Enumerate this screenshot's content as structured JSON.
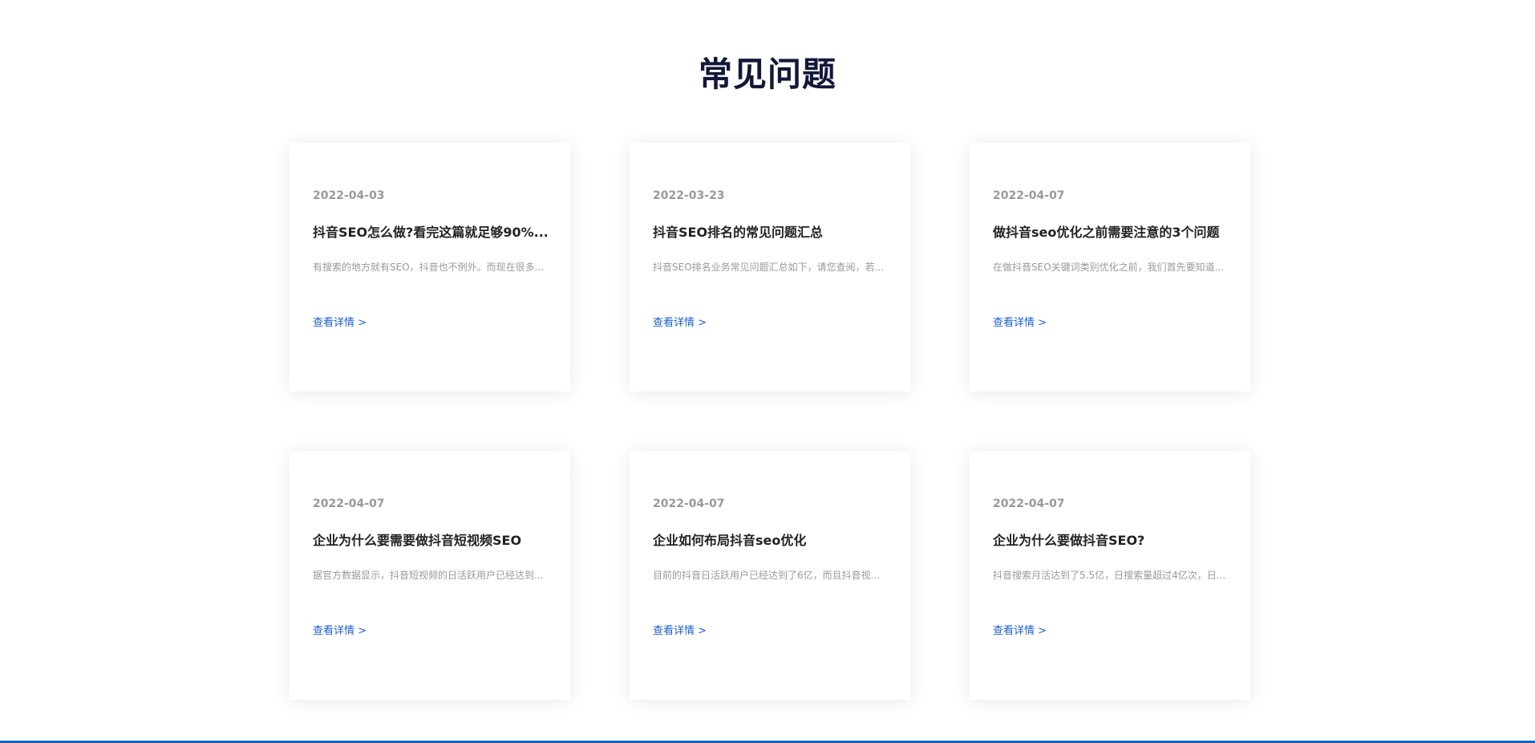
{
  "section": {
    "title": "常见问题"
  },
  "cards": [
    {
      "date": "2022-04-03",
      "title": "抖音SEO怎么做?看完这篇就足够90%...",
      "summary": "有搜索的地方就有SEO，抖音也不例外。而现在很多...",
      "link": "查看详情 >"
    },
    {
      "date": "2022-03-23",
      "title": "抖音SEO排名的常见问题汇总",
      "summary": "抖音SEO排名业务常见问题汇总如下，请您查阅，若...",
      "link": "查看详情 >"
    },
    {
      "date": "2022-04-07",
      "title": "做抖音seo优化之前需要注意的3个问题",
      "summary": "在做抖音SEO关键词类别优化之前，我们首先要知道...",
      "link": "查看详情 >"
    },
    {
      "date": "2022-04-07",
      "title": "企业为什么要需要做抖音短视频SEO",
      "summary": "据官方数据显示，抖音短视频的日活跃用户已经达到...",
      "link": "查看详情 >"
    },
    {
      "date": "2022-04-07",
      "title": "企业如何布局抖音seo优化",
      "summary": "目前的抖音日活跃用户已经达到了6亿，而且抖音视...",
      "link": "查看详情 >"
    },
    {
      "date": "2022-04-07",
      "title": "企业为什么要做抖音SEO?",
      "summary": "抖音搜索月活达到了5.5亿，日搜索量超过4亿次，日...",
      "link": "查看详情 >"
    }
  ],
  "colors": {
    "title": "#131838",
    "link": "#1a5fd6",
    "muted": "#999999",
    "bottom_bar": "#1565c0"
  }
}
